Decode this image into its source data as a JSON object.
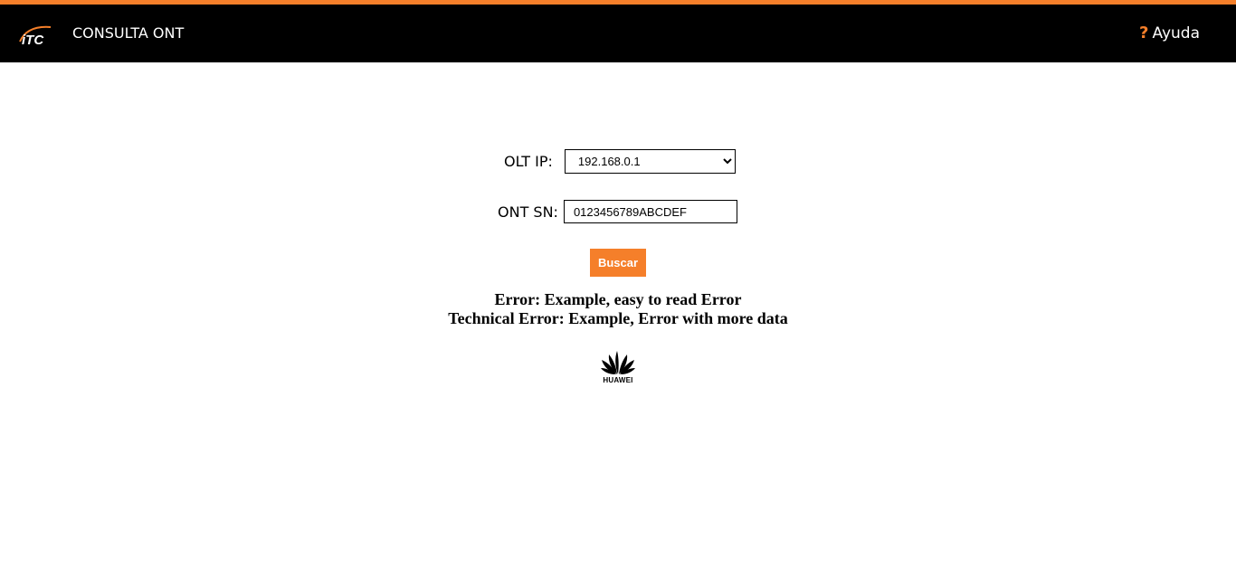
{
  "header": {
    "logo_text": "iTC",
    "title": "CONSULTA ONT",
    "help_label": "Ayuda",
    "help_icon": "?"
  },
  "form": {
    "olt_label": "OLT IP:",
    "olt_selected": "192.168.0.1",
    "ont_label": "ONT SN:",
    "ont_value": "0123456789ABCDEF",
    "submit_label": "Buscar"
  },
  "messages": {
    "error": "Error: Example, easy to read Error",
    "technical_error": "Technical Error: Example, Error with more data"
  },
  "footer_logo": {
    "name": "huawei-logo",
    "text": "HUAWEI"
  },
  "colors": {
    "accent": "#f57f2a",
    "header_bg": "#000000"
  }
}
